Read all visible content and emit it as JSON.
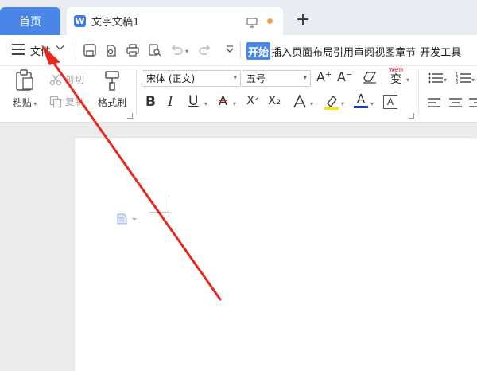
{
  "tabs": {
    "home": "首页",
    "doc_icon_letter": "W",
    "doc_title": "文字文稿1",
    "new_tab": "+"
  },
  "menu": {
    "file": "文件",
    "active_tab": "开始",
    "tabs": [
      "插入",
      "页面布局",
      "引用",
      "审阅",
      "视图",
      "章节",
      "开发工具"
    ]
  },
  "ribbon": {
    "paste": "粘贴",
    "cut": "剪切",
    "copy": "复制",
    "format_painter": "格式刷",
    "font_name": "宋体 (正文)",
    "font_size": "五号",
    "grow": "A⁺",
    "shrink": "A⁻",
    "pinyin_top": "wén",
    "pinyin_char": "变",
    "bold": "B",
    "italic": "I",
    "underline": "U",
    "strike": "A",
    "superscript": "X²",
    "subscript": "X₂",
    "font_color_letter": "A",
    "char_border": "A"
  },
  "colors": {
    "accent": "#4a86e8",
    "annotation_arrow": "#e8281e",
    "unsaved_dot": "#f0a050",
    "highlight": "#ffe400",
    "font_color_bar": "#1f3ecf"
  }
}
